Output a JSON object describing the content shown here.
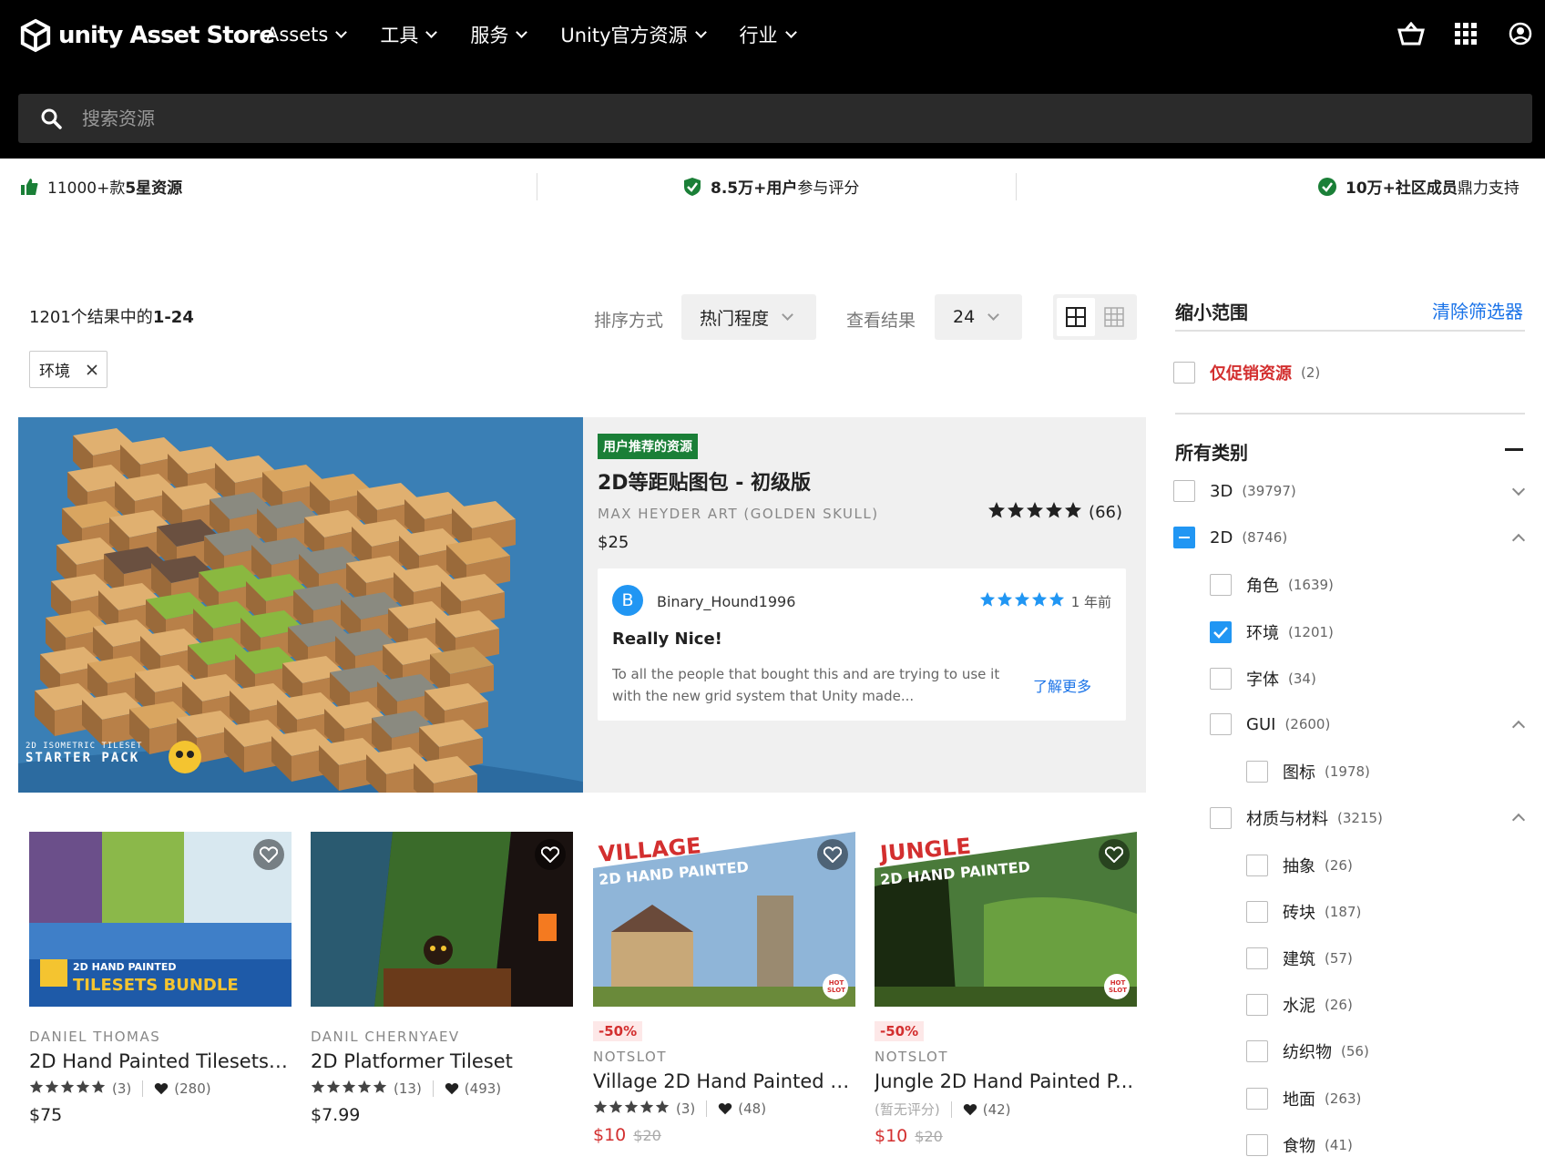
{
  "header": {
    "logo_text": "unity Asset Store",
    "nav": [
      {
        "label": "Assets"
      },
      {
        "label": "工具"
      },
      {
        "label": "服务"
      },
      {
        "label": "Unity官方资源"
      },
      {
        "label": "行业"
      }
    ],
    "search_placeholder": "搜索资源"
  },
  "trust_bar": {
    "item1_pre": "11000+款",
    "item1_bold": "5星资源",
    "item2_bold": "8.5万+用户",
    "item2_post": "参与评分",
    "item3_bold": "10万+社区成员",
    "item3_post": "鼎力支持",
    "accent_color": "#1a7f37"
  },
  "results": {
    "count_pre": "1201个结果中的",
    "count_bold": "1-24",
    "sort_label": "排序方式",
    "sort_value": "热门程度",
    "view_label": "查看结果",
    "view_value": "24",
    "active_filter": "环境"
  },
  "featured": {
    "badge": "用户推荐的资源",
    "title": "2D等距贴图包 - 初级版",
    "publisher": "MAX HEYDER ART (GOLDEN SKULL)",
    "rating": 5,
    "rating_count": "(66)",
    "price": "$25",
    "image_caption_line1": "2D ISOMETRIC TILESET",
    "image_caption_line2": "STARTER PACK",
    "review": {
      "avatar_letter": "B",
      "user": "Binary_Hound1996",
      "stars": 5,
      "time": "1 年前",
      "title": "Really Nice!",
      "body": "To all the people that bought this and are trying to use it with the new grid system that Unity made...",
      "more": "了解更多"
    }
  },
  "cards": [
    {
      "publisher": "DANIEL THOMAS",
      "name": "2D Hand Painted Tilesets ...",
      "rating_count": "(3)",
      "favorites": "(280)",
      "price": "$75",
      "discount": "",
      "orig_price": "",
      "img_text_small": "2D HAND PAINTED",
      "img_text_big": "TILESETS BUNDLE"
    },
    {
      "publisher": "DANIL CHERNYAEV",
      "name": "2D Platformer Tileset",
      "rating_count": "(13)",
      "favorites": "(493)",
      "price": "$7.99",
      "discount": "",
      "orig_price": ""
    },
    {
      "publisher": "NOTSLOT",
      "name": "Village 2D Hand Painted P...",
      "rating_count": "(3)",
      "favorites": "(48)",
      "price": "$10",
      "discount": "-50%",
      "orig_price": "$20",
      "img_text_big": "VILLAGE",
      "img_text_small": "2D HAND PAINTED",
      "corner_badge": "HOT SLOT"
    },
    {
      "publisher": "NOTSLOT",
      "name": "Jungle 2D Hand Painted P...",
      "rating_count": "(暂无评分)",
      "favorites": "(42)",
      "price": "$10",
      "discount": "-50%",
      "orig_price": "$20",
      "img_text_big": "JUNGLE",
      "img_text_small": "2D HAND PAINTED",
      "corner_badge": "HOT SLOT"
    }
  ],
  "sidebar": {
    "title": "缩小范围",
    "clear": "清除筛选器",
    "promo": {
      "label": "仅促销资源",
      "count": "(2)"
    },
    "section_title": "所有类别",
    "categories": [
      {
        "label": "3D",
        "count": "(39797)"
      },
      {
        "label": "2D",
        "count": "(8746)"
      },
      {
        "label": "角色",
        "count": "(1639)"
      },
      {
        "label": "环境",
        "count": "(1201)"
      },
      {
        "label": "字体",
        "count": "(34)"
      },
      {
        "label": "GUI",
        "count": "(2600)"
      },
      {
        "label": "图标",
        "count": "(1978)"
      },
      {
        "label": "材质与材料",
        "count": "(3215)"
      },
      {
        "label": "抽象",
        "count": "(26)"
      },
      {
        "label": "砖块",
        "count": "(187)"
      },
      {
        "label": "建筑",
        "count": "(57)"
      },
      {
        "label": "水泥",
        "count": "(26)"
      },
      {
        "label": "纺织物",
        "count": "(56)"
      },
      {
        "label": "地面",
        "count": "(263)"
      },
      {
        "label": "食物",
        "count": "(41)"
      }
    ]
  },
  "colors": {
    "link": "#1a73e8",
    "checkbox": "#2196f3",
    "sale": "#d32f2f",
    "badge": "#1a7f37"
  }
}
